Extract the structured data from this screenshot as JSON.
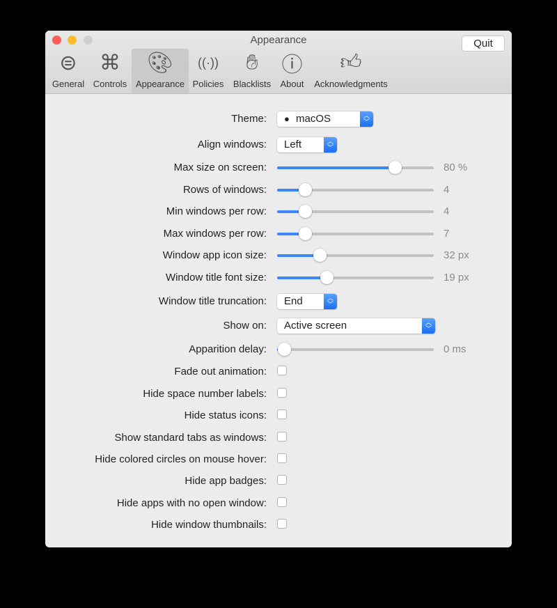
{
  "window": {
    "title": "Appearance",
    "quit_label": "Quit"
  },
  "tabs": [
    {
      "label": "General",
      "icon": "toggle-icon"
    },
    {
      "label": "Controls",
      "icon": "command-icon"
    },
    {
      "label": "Appearance",
      "icon": "palette-icon",
      "selected": true
    },
    {
      "label": "Policies",
      "icon": "antenna-icon"
    },
    {
      "label": "Blacklists",
      "icon": "hand-icon"
    },
    {
      "label": "About",
      "icon": "info-icon"
    },
    {
      "label": "Acknowledgments",
      "icon": "thumbs-up-icon"
    }
  ],
  "settings": [
    {
      "type": "popup",
      "label": "Theme:",
      "value": "macOS",
      "icon": "apple-icon"
    },
    {
      "type": "popup",
      "label": "Align windows:",
      "value": "Left"
    },
    {
      "type": "slider",
      "label": "Max size on screen:",
      "value": "80 %",
      "position": 0.78
    },
    {
      "type": "slider",
      "label": "Rows of windows:",
      "value": "4",
      "position": 0.15
    },
    {
      "type": "slider",
      "label": "Min windows per row:",
      "value": "4",
      "position": 0.15
    },
    {
      "type": "slider",
      "label": "Max windows per row:",
      "value": "7",
      "position": 0.15
    },
    {
      "type": "slider",
      "label": "Window app icon size:",
      "value": "32 px",
      "position": 0.25
    },
    {
      "type": "slider",
      "label": "Window title font size:",
      "value": "19 px",
      "position": 0.3
    },
    {
      "type": "popup",
      "label": "Window title truncation:",
      "value": "End"
    },
    {
      "type": "popup",
      "label": "Show on:",
      "value": "Active screen"
    },
    {
      "type": "slider",
      "label": "Apparition delay:",
      "value": "0 ms",
      "position": 0
    },
    {
      "type": "checkbox",
      "label": "Fade out animation:",
      "checked": false
    },
    {
      "type": "checkbox",
      "label": "Hide space number labels:",
      "checked": false
    },
    {
      "type": "checkbox",
      "label": "Hide status icons:",
      "checked": false
    },
    {
      "type": "checkbox",
      "label": "Show standard tabs as windows:",
      "checked": false
    },
    {
      "type": "checkbox",
      "label": "Hide colored circles on mouse hover:",
      "checked": false
    },
    {
      "type": "checkbox",
      "label": "Hide app badges:",
      "checked": false
    },
    {
      "type": "checkbox",
      "label": "Hide apps with no open window:",
      "checked": false
    },
    {
      "type": "checkbox",
      "label": "Hide window thumbnails:",
      "checked": false
    }
  ],
  "colors": {
    "accent": "#3b86f6",
    "close": "#fd5f57",
    "minimize": "#febc2e",
    "zoom_disabled": "#cfcfcf"
  }
}
